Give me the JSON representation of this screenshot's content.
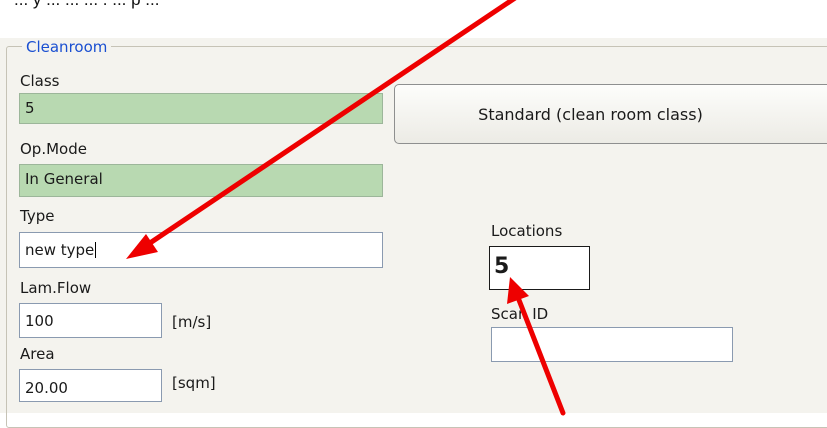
{
  "caption": "... y  ... ... ... . ... p ...",
  "group": {
    "legend": "Cleanroom"
  },
  "fields": {
    "class": {
      "label": "Class",
      "value": "5"
    },
    "op_mode": {
      "label": "Op.Mode",
      "value": "In General"
    },
    "type": {
      "label": "Type",
      "value": "new type"
    },
    "lam_flow": {
      "label": "Lam.Flow",
      "value": "100",
      "unit": "[m/s]"
    },
    "area": {
      "label": "Area",
      "value": "20.00",
      "unit": "[sqm]"
    },
    "locations": {
      "label": "Locations",
      "value": "5"
    },
    "scan_id": {
      "label": "Scan ID",
      "value": ""
    }
  },
  "buttons": {
    "standard": "Standard (clean room class)"
  },
  "colors": {
    "readonly_field": "#b8d9b1",
    "legend": "#1a4fd1",
    "annotation_arrow": "#ee0000"
  },
  "annotations": {
    "arrow_icon": "red-arrow-icon"
  }
}
